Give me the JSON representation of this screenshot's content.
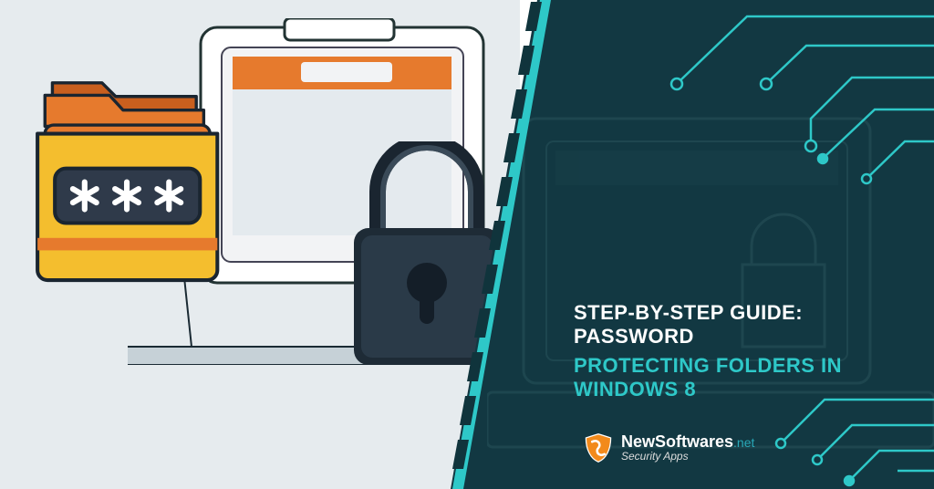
{
  "title": {
    "line1": "STEP-BY-STEP GUIDE: PASSWORD",
    "line2": "PROTECTING FOLDERS IN WINDOWS 8"
  },
  "brand": {
    "name": "NewSoftwares",
    "domain": ".net",
    "tagline": "Security Apps"
  },
  "colors": {
    "accent": "#2EC8C8",
    "dark": "#123842",
    "folder_orange": "#E67A2D",
    "folder_yellow": "#F4BE2E",
    "folder_deep": "#C95F1E",
    "password_bg": "#2F3A4A"
  },
  "icons": {
    "folder": "folder-icon",
    "lock": "lock-icon",
    "shield": "shield-icon"
  }
}
